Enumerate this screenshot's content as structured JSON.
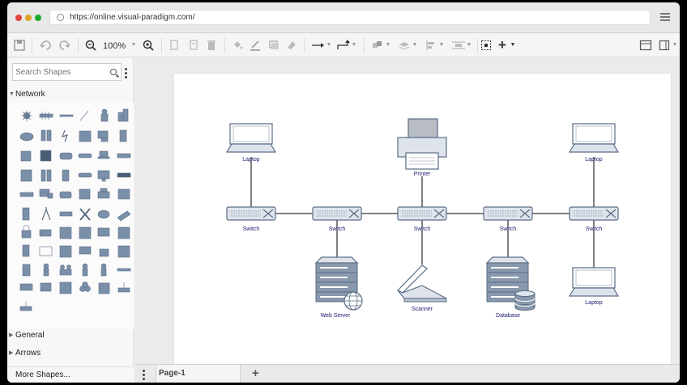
{
  "browser": {
    "url": "https://online.visual-paradigm.com/",
    "colors": {
      "close": "#e0443e",
      "minimize": "#dea123",
      "maximize": "#1aab29"
    }
  },
  "toolbar": {
    "zoom_label": "100%",
    "icons": [
      "save-icon",
      "undo-icon",
      "redo-icon",
      "zoom-out-icon",
      "zoom-in-icon",
      "copy-icon",
      "paste-icon",
      "delete-icon",
      "fill-color-icon",
      "line-color-icon",
      "shadow-icon",
      "format-painter-icon",
      "connector-straight-icon",
      "connector-elbow-icon",
      "arrange-icon",
      "layer-icon",
      "align-icon",
      "distribute-icon",
      "select-icon",
      "insert-plus-icon",
      "format-panel-icon",
      "sidebar-toggle-icon"
    ]
  },
  "sidebar": {
    "search_placeholder": "Search Shapes",
    "sections": [
      {
        "label": "Network",
        "expanded": true
      },
      {
        "label": "General",
        "expanded": false
      },
      {
        "label": "Arrows",
        "expanded": false
      }
    ],
    "more_shapes_label": "More Shapes..."
  },
  "diagram": {
    "labels": {
      "laptop_left": "Laptop",
      "printer": "Printer",
      "laptop_right": "Laptop",
      "switch_1": "Switch",
      "switch_2": "Switch",
      "switch_3": "Switch",
      "switch_4": "Switch",
      "switch_5": "Switch",
      "web_server": "Web Server",
      "scanner": "Scanner",
      "database": "Database",
      "laptop_bottom": "Laptop"
    }
  },
  "pages": {
    "tabs": [
      "Page-1"
    ],
    "active": "Page-1"
  }
}
